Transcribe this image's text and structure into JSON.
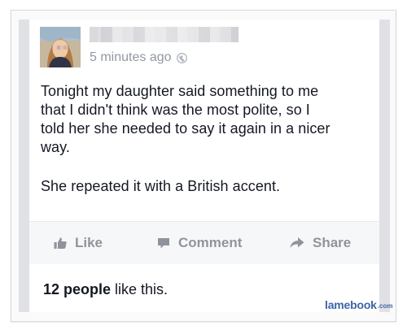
{
  "post": {
    "timestamp": "5 minutes ago",
    "body_lines": [
      "Tonight my daughter said something to me",
      "that I didn't think was the most polite, so I",
      "told her she needed to say it again in a nicer",
      "way.",
      "She repeated it with a British accent."
    ]
  },
  "actions": {
    "like_label": "Like",
    "comment_label": "Comment",
    "share_label": "Share"
  },
  "likes": {
    "count_text": "12 people",
    "suffix_text": " like this."
  },
  "watermark": {
    "main": "lamebook",
    "suffix": ".com"
  },
  "icons": {
    "timestamp": "globe-icon",
    "like": "thumbs-up-icon",
    "comment": "comment-icon",
    "share": "share-arrow-icon"
  },
  "colors": {
    "text_primary": "#141823",
    "text_muted": "#9198a3",
    "action_text": "#8f949c",
    "action_bg": "#f6f7f9",
    "side_bar": "#e0e1e5",
    "watermark": "#3e64a8"
  }
}
